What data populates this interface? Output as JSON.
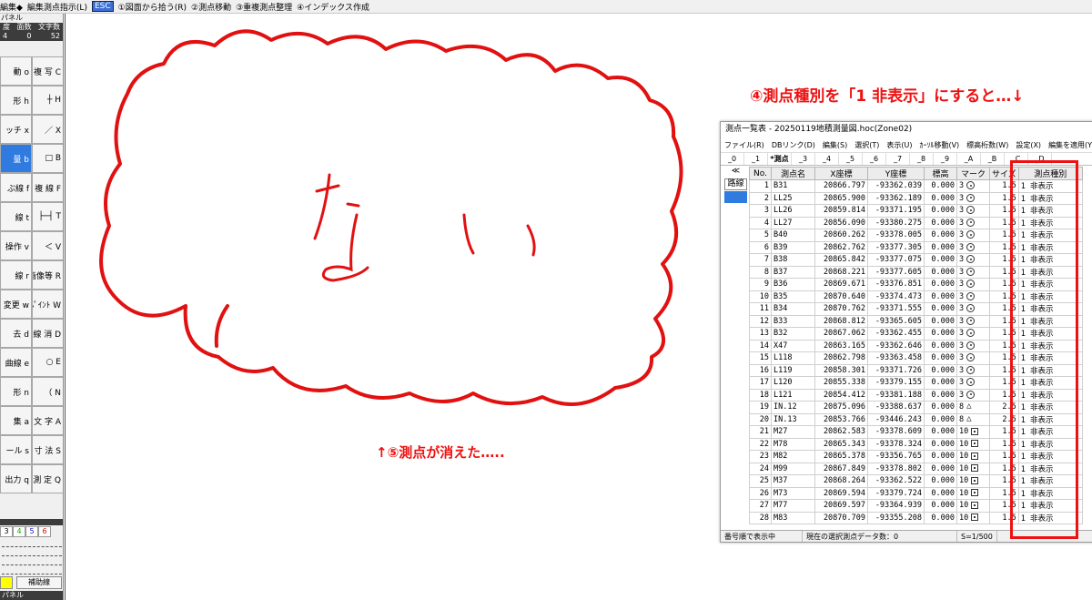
{
  "topbar": {
    "items": [
      "編集◆",
      "編集測点指示(L)",
      "ESC",
      "①図面から拾う(R)",
      "②測点移動",
      "③重複測点整理",
      "④インデックス作成"
    ]
  },
  "leftpanel": {
    "title": "パネル",
    "headers": [
      "度",
      "面数",
      "文字数"
    ],
    "values": [
      "4",
      "0",
      "52"
    ],
    "buttons": [
      [
        "動 o",
        "複 写 C"
      ],
      [
        "形 h",
        "┼ H"
      ],
      [
        "ッチ x",
        "／ X"
      ],
      [
        "量 b",
        "□ B"
      ],
      [
        "ぶ線 f",
        "複 線 F"
      ],
      [
        "線 t",
        "├─┤ T"
      ],
      [
        "操作 v",
        "＜ V"
      ],
      [
        "線 r",
        "画像等 R"
      ],
      [
        "変更 w",
        "ﾍﾟｲﾝﾄ W"
      ],
      [
        "去 d",
        "線 消 D"
      ],
      [
        "曲線 e",
        "○ E"
      ],
      [
        "形 n",
        "（ N"
      ],
      [
        "集 a",
        "文 字 A"
      ],
      [
        "ール s",
        "寸 法 S"
      ],
      [
        "出力 q",
        "測 定 Q"
      ]
    ],
    "selected_button": "量 b",
    "colors": [
      "3",
      "4",
      "5",
      "6"
    ],
    "aux_line": "補助線",
    "panel2_title": "パネル"
  },
  "notes": {
    "note4": "④測点種別を「1 非表示」にすると…↓",
    "note5": "↑⑤測点が消えた…..",
    "handwritten": "ない"
  },
  "window": {
    "title": "測点一覧表 - 20250119地積測量図.hoc(Zone02)",
    "menu": [
      "ファイル(R)",
      "DBリンク(D)",
      "編集(S)",
      "選択(T)",
      "表示(U)",
      "ｶｰｿﾙ移動(V)",
      "標高桁数(W)",
      "設定(X)",
      "編集を適用(Y)"
    ],
    "tabs": [
      "_0",
      "_1",
      "*測点",
      "_3",
      "_4",
      "_5",
      "_6",
      "_7",
      "_8",
      "_9",
      "_A",
      "_B",
      "_C",
      "_D"
    ],
    "side_btn": "≪",
    "side_item": "路線",
    "columns": [
      "No.",
      "測点名",
      "X座標",
      "Y座標",
      "標高",
      "マーク",
      "サイズ",
      "測点種別"
    ],
    "rows": [
      [
        "1",
        "B31",
        "20866.797",
        "-93362.039",
        "0.000",
        "3",
        "circle",
        "1.5",
        "1 非表示"
      ],
      [
        "2",
        "LL25",
        "20865.900",
        "-93362.189",
        "0.000",
        "3",
        "circle",
        "1.5",
        "1 非表示"
      ],
      [
        "3",
        "LL26",
        "20859.814",
        "-93371.195",
        "0.000",
        "3",
        "circle",
        "1.5",
        "1 非表示"
      ],
      [
        "4",
        "LL27",
        "20856.090",
        "-93380.275",
        "0.000",
        "3",
        "circle",
        "1.5",
        "1 非表示"
      ],
      [
        "5",
        "B40",
        "20860.262",
        "-93378.005",
        "0.000",
        "3",
        "circle",
        "1.5",
        "1 非表示"
      ],
      [
        "6",
        "B39",
        "20862.762",
        "-93377.305",
        "0.000",
        "3",
        "circle",
        "1.5",
        "1 非表示"
      ],
      [
        "7",
        "B38",
        "20865.842",
        "-93377.075",
        "0.000",
        "3",
        "circle",
        "1.5",
        "1 非表示"
      ],
      [
        "8",
        "B37",
        "20868.221",
        "-93377.605",
        "0.000",
        "3",
        "circle",
        "1.5",
        "1 非表示"
      ],
      [
        "9",
        "B36",
        "20869.671",
        "-93376.851",
        "0.000",
        "3",
        "circle",
        "1.5",
        "1 非表示"
      ],
      [
        "10",
        "B35",
        "20870.640",
        "-93374.473",
        "0.000",
        "3",
        "circle",
        "1.5",
        "1 非表示"
      ],
      [
        "11",
        "B34",
        "20870.762",
        "-93371.555",
        "0.000",
        "3",
        "circle",
        "1.5",
        "1 非表示"
      ],
      [
        "12",
        "B33",
        "20868.812",
        "-93365.605",
        "0.000",
        "3",
        "circle",
        "1.5",
        "1 非表示"
      ],
      [
        "13",
        "B32",
        "20867.062",
        "-93362.455",
        "0.000",
        "3",
        "circle",
        "1.5",
        "1 非表示"
      ],
      [
        "14",
        "X47",
        "20863.165",
        "-93362.646",
        "0.000",
        "3",
        "circle",
        "1.5",
        "1 非表示"
      ],
      [
        "15",
        "L118",
        "20862.798",
        "-93363.458",
        "0.000",
        "3",
        "circle",
        "1.5",
        "1 非表示"
      ],
      [
        "16",
        "L119",
        "20858.301",
        "-93371.726",
        "0.000",
        "3",
        "circle",
        "1.5",
        "1 非表示"
      ],
      [
        "17",
        "L120",
        "20855.338",
        "-93379.155",
        "0.000",
        "3",
        "circle",
        "1.5",
        "1 非表示"
      ],
      [
        "18",
        "L121",
        "20854.412",
        "-93381.188",
        "0.000",
        "3",
        "circle",
        "1.5",
        "1 非表示"
      ],
      [
        "19",
        "IN.12",
        "20875.096",
        "-93388.637",
        "0.000",
        "8",
        "triangle",
        "2.5",
        "1 非表示"
      ],
      [
        "20",
        "IN.13",
        "20853.766",
        "-93446.243",
        "0.000",
        "8",
        "triangle",
        "2.5",
        "1 非表示"
      ],
      [
        "21",
        "M27",
        "20862.583",
        "-93378.609",
        "0.000",
        "10",
        "square",
        "1.5",
        "1 非表示"
      ],
      [
        "22",
        "M78",
        "20865.343",
        "-93378.324",
        "0.000",
        "10",
        "square",
        "1.5",
        "1 非表示"
      ],
      [
        "23",
        "M82",
        "20865.378",
        "-93356.765",
        "0.000",
        "10",
        "square",
        "1.5",
        "1 非表示"
      ],
      [
        "24",
        "M99",
        "20867.849",
        "-93378.802",
        "0.000",
        "10",
        "square",
        "1.5",
        "1 非表示"
      ],
      [
        "25",
        "M37",
        "20868.264",
        "-93362.522",
        "0.000",
        "10",
        "square",
        "1.5",
        "1 非表示"
      ],
      [
        "26",
        "M73",
        "20869.594",
        "-93379.724",
        "0.000",
        "10",
        "square",
        "1.5",
        "1 非表示"
      ],
      [
        "27",
        "M77",
        "20869.597",
        "-93364.939",
        "0.000",
        "10",
        "square",
        "1.5",
        "1 非表示"
      ],
      [
        "28",
        "M83",
        "20870.709",
        "-93355.208",
        "0.000",
        "10",
        "square",
        "1.5",
        "1 非表示"
      ]
    ],
    "status": [
      "番号順で表示中",
      "現在の選択測点データ数：0",
      "S=1/500"
    ]
  },
  "colors": {
    "annotation_red": "#e11111",
    "selection_blue": "#2f7be0"
  }
}
